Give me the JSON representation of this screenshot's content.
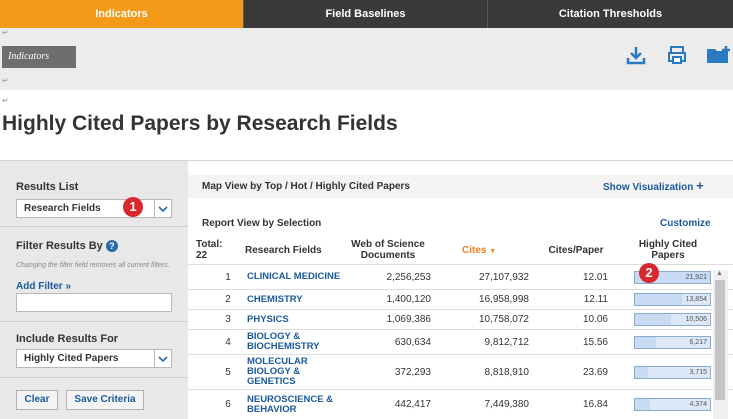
{
  "tabs": [
    {
      "label": "Indicators",
      "active": true
    },
    {
      "label": "Field Baselines",
      "active": false
    },
    {
      "label": "Citation Thresholds",
      "active": false
    }
  ],
  "toolbar": {
    "indicators_label": "Indicators",
    "icons": [
      "download-icon",
      "print-icon",
      "add-folder-icon"
    ]
  },
  "page_title": "Highly Cited Papers by Research Fields",
  "sidebar": {
    "results_list_label": "Results List",
    "results_list_value": "Research Fields",
    "filter_label": "Filter Results By",
    "filter_note": "Changing the filter field removes all current filters.",
    "add_filter": "Add Filter »",
    "include_label": "Include Results For",
    "include_value": "Highly Cited Papers",
    "clear_label": "Clear",
    "save_label": "Save Criteria",
    "badge1": "1"
  },
  "main": {
    "map_view": "Map View by Top / Hot / Highly Cited Papers",
    "show_visualization": "Show Visualization",
    "report_view": "Report View by Selection",
    "customize": "Customize",
    "badge2": "2",
    "headers": {
      "total": "Total:\n22",
      "field": "Research Fields",
      "wos": "Web of Science\nDocuments",
      "cites": "Cites",
      "cpp": "Cites/Paper",
      "hcp": "Highly Cited\nPapers"
    },
    "rows": [
      {
        "rank": "1",
        "field": "CLINICAL MEDICINE",
        "wos": "2,256,253",
        "cites": "27,107,932",
        "cpp": "12.01",
        "hcp": "21,921",
        "hcp_value": 21921
      },
      {
        "rank": "2",
        "field": "CHEMISTRY",
        "wos": "1,400,120",
        "cites": "16,958,998",
        "cpp": "12.11",
        "hcp": "13,854",
        "hcp_value": 13854
      },
      {
        "rank": "3",
        "field": "PHYSICS",
        "wos": "1,069,386",
        "cites": "10,758,072",
        "cpp": "10.06",
        "hcp": "10,506",
        "hcp_value": 10506
      },
      {
        "rank": "4",
        "field": "BIOLOGY & BIOCHEMISTRY",
        "wos": "630,634",
        "cites": "9,812,712",
        "cpp": "15.56",
        "hcp": "6,217",
        "hcp_value": 6217
      },
      {
        "rank": "5",
        "field": "MOLECULAR BIOLOGY & GENETICS",
        "wos": "372,293",
        "cites": "8,818,910",
        "cpp": "23.69",
        "hcp": "3,715",
        "hcp_value": 3715
      },
      {
        "rank": "6",
        "field": "NEUROSCIENCE & BEHAVIOR",
        "wos": "442,417",
        "cites": "7,449,380",
        "cpp": "16.84",
        "hcp": "4,374",
        "hcp_value": 4374
      }
    ]
  },
  "colors": {
    "accent": "#f39a1a",
    "nav": "#3a3a3a",
    "link": "#1a5a9a",
    "badge": "#d9272e",
    "cites_header": "#f08020"
  }
}
